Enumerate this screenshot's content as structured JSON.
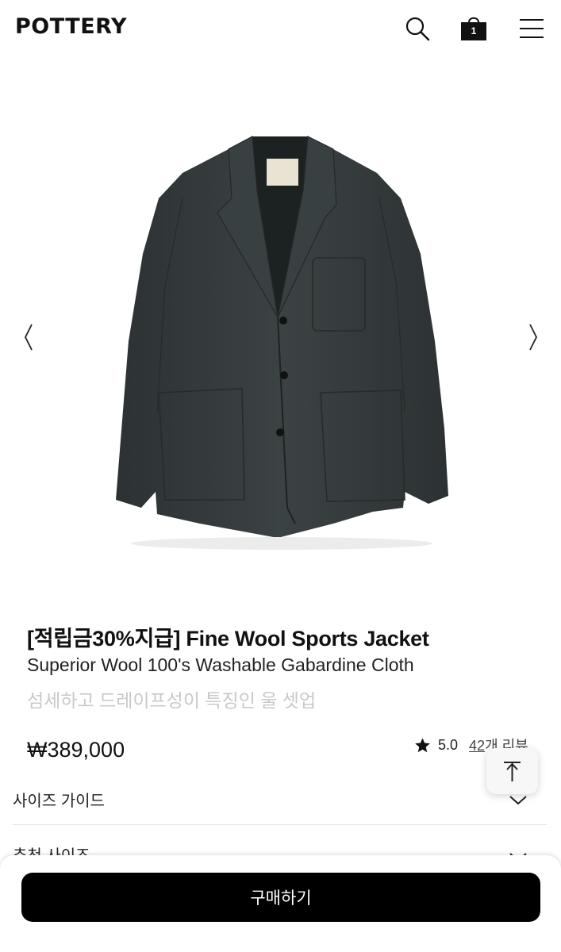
{
  "header": {
    "logo": "POTTERY",
    "cart_count": "1",
    "icons": [
      "search-icon",
      "shopping-bag-icon",
      "hamburger-menu-icon"
    ]
  },
  "gallery": {
    "image": "dark-charcoal-wool-sports-jacket",
    "prev_icon": "chevron-left-icon",
    "next_icon": "chevron-right-icon"
  },
  "product": {
    "title": "[적립금30%지급] Fine Wool Sports Jacket",
    "subtitle": "Superior Wool 100's Washable Gabardine Cloth",
    "description": "섬세하고 드레이프성이 특징인 울 셋업",
    "price": "₩389,000",
    "rating": "5.0",
    "review_count": "42",
    "review_suffix": "개 리뷰"
  },
  "sections": {
    "size_guide": "사이즈 가이드",
    "recommended_size": "추천 사이즈"
  },
  "actions": {
    "buy_label": "구매하기",
    "scroll_top_icon": "arrow-up-icon"
  },
  "colors": {
    "button_bg": "#000000",
    "muted_text": "#c9c9c9",
    "jacket": "#33393a"
  }
}
